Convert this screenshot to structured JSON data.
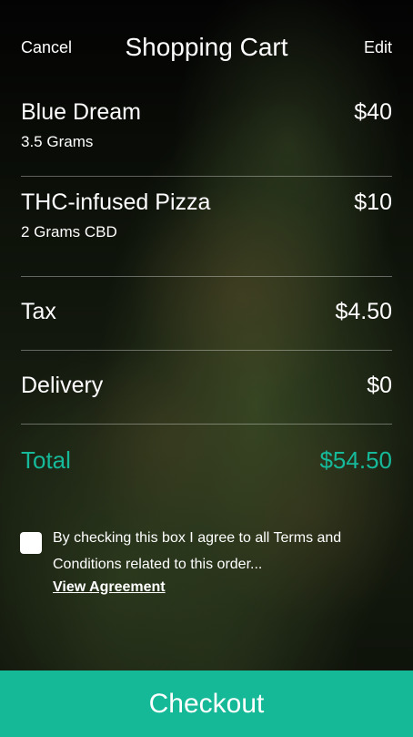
{
  "nav": {
    "cancel_label": "Cancel",
    "title": "Shopping Cart",
    "edit_label": "Edit"
  },
  "cart": {
    "items": [
      {
        "name": "Blue Dream",
        "detail": "3.5 Grams",
        "price": "$40"
      },
      {
        "name": "THC-infused Pizza",
        "detail": "2 Grams CBD",
        "price": "$10"
      }
    ],
    "tax": {
      "label": "Tax",
      "value": "$4.50"
    },
    "delivery": {
      "label": "Delivery",
      "value": "$0"
    },
    "total": {
      "label": "Total",
      "value": "$54.50"
    }
  },
  "agreement": {
    "checked": false,
    "text": "By checking this box I agree to all Terms and Conditions related to this order...",
    "link_label": "View Agreement"
  },
  "checkout_label": "Checkout",
  "colors": {
    "accent": "#15b998",
    "text": "#ffffff"
  }
}
